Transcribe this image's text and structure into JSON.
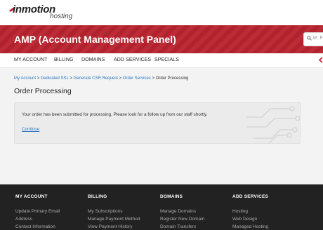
{
  "header": {
    "brand": "inmotion",
    "brand_sub": "hosting"
  },
  "banner": {
    "title": "AMP (Account Management Panel)",
    "search_placeholder": "ie: F"
  },
  "nav": {
    "items": [
      "MY ACCOUNT",
      "BILLING",
      "DOMAINS",
      "ADD SERVICES",
      "SPECIALS"
    ]
  },
  "breadcrumb": {
    "links": [
      "My Account",
      "Dedicated SSL",
      "Generate CSR Request",
      "Order Services"
    ],
    "separator": ">",
    "current": "Order Processing"
  },
  "page": {
    "title": "Order Processing"
  },
  "panel": {
    "message": "Your order has been submitted for processing. Please look for a follow up from our staff shortly.",
    "continue_label": "Continue"
  },
  "footer": {
    "columns": [
      {
        "heading": "MY ACCOUNT",
        "links": [
          "Update Primary Email",
          "Address",
          "Contact Information"
        ]
      },
      {
        "heading": "BILLING",
        "links": [
          "My Subscriptions",
          "Manage Payment Method",
          "View Payment History"
        ]
      },
      {
        "heading": "DOMAINS",
        "links": [
          "Manage Domains",
          "Register New Domain",
          "Domain Transfers"
        ]
      },
      {
        "heading": "ADD SERVICES",
        "links": [
          "Hosting",
          "Web Design",
          "Managed Hosting"
        ]
      }
    ]
  },
  "colors": {
    "banner": "#b8232f",
    "link": "#2b78c5",
    "footer": "#222222"
  }
}
